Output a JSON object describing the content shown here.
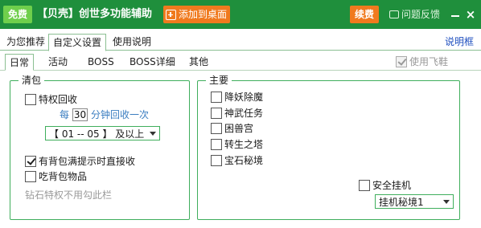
{
  "titlebar": {
    "badge": "免费",
    "title": "【贝壳】创世多功能辅助",
    "add_desktop": "添加到桌面",
    "renew": "续费",
    "feedback": "问题反馈",
    "minimize": "—",
    "close": "×",
    "bg_color": "#1f8f3c"
  },
  "tabs": [
    {
      "label": "为您推荐"
    },
    {
      "label": "自定义设置"
    },
    {
      "label": "使用说明"
    }
  ],
  "description_link": "说明框",
  "subtabs": [
    {
      "label": "日常"
    },
    {
      "label": "活动"
    },
    {
      "label": "BOSS"
    },
    {
      "label": "BOSS详细"
    },
    {
      "label": "其他"
    }
  ],
  "use_shoes": {
    "label": "使用飞鞋",
    "checked": true,
    "enabled": false
  },
  "left_group": {
    "title": "清包",
    "privilege_recycle": {
      "label": "特权回收",
      "checked": false
    },
    "every_prefix": "每",
    "interval_value": "30",
    "every_suffix": "分钟回收一次",
    "level_select": "【 01 -- 05 】 及以上",
    "full_bag_recycle": {
      "label": "有背包满提示时直接收",
      "checked": true
    },
    "eat_bag_items": {
      "label": "吃背包物品",
      "checked": false
    },
    "hint": "钻石特权不用勾此栏"
  },
  "right_group": {
    "title": "主要",
    "items": [
      {
        "label": "降妖除魔",
        "checked": false
      },
      {
        "label": "神武任务",
        "checked": false
      },
      {
        "label": "困兽宫",
        "checked": false
      },
      {
        "label": "转生之塔",
        "checked": false
      },
      {
        "label": "宝石秘境",
        "checked": false
      }
    ],
    "safe_hook": {
      "label": "安全挂机",
      "checked": false
    },
    "hook_select": "挂机秘境1"
  }
}
